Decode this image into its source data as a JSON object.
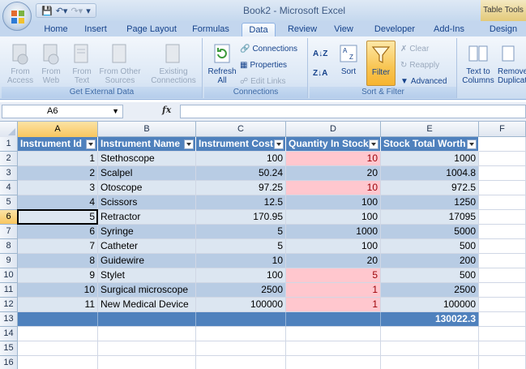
{
  "window": {
    "title": "Book2 - Microsoft Excel",
    "context_tab": "Table Tools"
  },
  "tabs": [
    "Home",
    "Insert",
    "Page Layout",
    "Formulas",
    "Data",
    "Review",
    "View",
    "Developer",
    "Add-Ins",
    "Design"
  ],
  "active_tab": "Data",
  "ribbon": {
    "get_external": {
      "label": "Get External Data",
      "from_access": "From Access",
      "from_web": "From Web",
      "from_text": "From Text",
      "from_other": "From Other Sources",
      "existing": "Existing Connections"
    },
    "connections": {
      "label": "Connections",
      "refresh": "Refresh All",
      "connections": "Connections",
      "properties": "Properties",
      "edit_links": "Edit Links"
    },
    "sort_filter": {
      "label": "Sort & Filter",
      "sort": "Sort",
      "filter": "Filter",
      "clear": "Clear",
      "reapply": "Reapply",
      "advanced": "Advanced"
    },
    "data_tools": {
      "text_to_columns": "Text to Columns",
      "remove_duplicates": "Remove Duplicates"
    }
  },
  "formula_bar": {
    "name_box": "A6",
    "fx": "fx",
    "value": ""
  },
  "columns": [
    "A",
    "B",
    "C",
    "D",
    "E",
    "F"
  ],
  "rows": [
    "1",
    "2",
    "3",
    "4",
    "5",
    "6",
    "7",
    "8",
    "9",
    "10",
    "11",
    "12",
    "13",
    "14",
    "15",
    "16"
  ],
  "table": {
    "headers": [
      "Instrument Id",
      "Instrument Name",
      "Instrument Cost",
      "Quantity In Stock",
      "Stock Total Worth"
    ],
    "data": [
      [
        "1",
        "Stethoscope",
        "100",
        "10",
        "1000"
      ],
      [
        "2",
        "Scalpel",
        "50.24",
        "20",
        "1004.8"
      ],
      [
        "3",
        "Otoscope",
        "97.25",
        "10",
        "972.5"
      ],
      [
        "4",
        "Scissors",
        "12.5",
        "100",
        "1250"
      ],
      [
        "5",
        "Retractor",
        "170.95",
        "100",
        "17095"
      ],
      [
        "6",
        "Syringe",
        "5",
        "1000",
        "5000"
      ],
      [
        "7",
        "Catheter",
        "5",
        "100",
        "500"
      ],
      [
        "8",
        "Guidewire",
        "10",
        "20",
        "200"
      ],
      [
        "9",
        "Stylet",
        "100",
        "5",
        "500"
      ],
      [
        "10",
        "Surgical microscope",
        "2500",
        "1",
        "2500"
      ],
      [
        "11",
        "New Medical Device",
        "100000",
        "1",
        "100000"
      ]
    ],
    "highlighted_qty_rows": [
      0,
      2,
      8,
      9,
      10
    ],
    "total": "130022.3"
  },
  "colors": {
    "table_header": "#4f81bd",
    "band_light": "#dce6f1",
    "band_dark": "#b8cce4",
    "highlight": "#ffc7ce",
    "highlight_text": "#9c0006"
  }
}
